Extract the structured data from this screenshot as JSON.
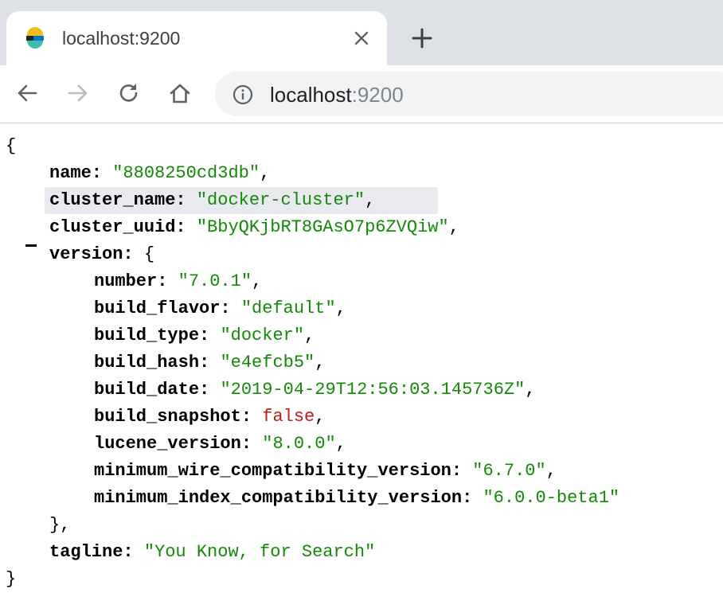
{
  "tab": {
    "title": "localhost:9200",
    "favicon": "elastic-logo",
    "close_icon": "close-icon",
    "new_tab_icon": "plus-icon"
  },
  "toolbar": {
    "back_icon": "arrow-left-icon",
    "forward_icon": "arrow-right-icon",
    "reload_icon": "reload-icon",
    "home_icon": "home-icon",
    "info_icon": "info-icon",
    "url_host": "localhost",
    "url_port": ":9200"
  },
  "json": {
    "open_brace": "{",
    "close_brace": "}",
    "name_key": "name:",
    "name_val": "\"8808250cd3db\"",
    "cluster_name_key": "cluster_name:",
    "cluster_name_val": "\"docker-cluster\"",
    "cluster_uuid_key": "cluster_uuid:",
    "cluster_uuid_val": "\"BbyQKjbRT8GAsO7p6ZVQiw\"",
    "version_key": "version:",
    "version_open": "{",
    "version_close": "},",
    "version": {
      "number_key": "number:",
      "number_val": "\"7.0.1\"",
      "build_flavor_key": "build_flavor:",
      "build_flavor_val": "\"default\"",
      "build_type_key": "build_type:",
      "build_type_val": "\"docker\"",
      "build_hash_key": "build_hash:",
      "build_hash_val": "\"e4efcb5\"",
      "build_date_key": "build_date:",
      "build_date_val": "\"2019-04-29T12:56:03.145736Z\"",
      "build_snapshot_key": "build_snapshot:",
      "build_snapshot_val": "false",
      "lucene_version_key": "lucene_version:",
      "lucene_version_val": "\"8.0.0\"",
      "min_wire_key": "minimum_wire_compatibility_version:",
      "min_wire_val": "\"6.7.0\"",
      "min_index_key": "minimum_index_compatibility_version:",
      "min_index_val": "\"6.0.0-beta1\""
    },
    "tagline_key": "tagline:",
    "tagline_val": "\"You Know, for Search\"",
    "comma": ","
  },
  "colors": {
    "string": "#138a07",
    "boolean": "#c41a16",
    "key": "#000000",
    "highlight": "#e8eaf0"
  }
}
